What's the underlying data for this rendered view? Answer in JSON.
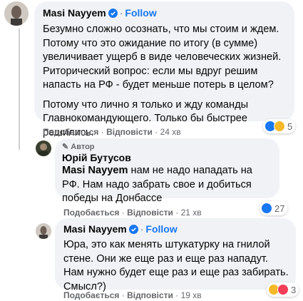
{
  "comment1": {
    "author": "Masi Nayyem",
    "follow_label": "Follow",
    "paragraph1": "Безумно сложно осознать, что мы стоим и ждем. Потому что это ожидание по итогу (в сумме) увеличивает ущерб в виде человеческих жизней. Риторический вопрос: если мы вдруг решим напасть на РФ - будет меньше потерь в целом?",
    "paragraph2": "Потому что лично я только и жду команды Главнокомандующего. Только бы быстрее решились.",
    "like_label": "Подобається",
    "reply_label": "Відповісти",
    "time": "24 хв",
    "reaction_count": "5"
  },
  "reply1": {
    "author_tag": "Автор",
    "author": "Юрій Бутусов",
    "mention": "Masi Nayyem",
    "text": " нам не надо нападать на РФ. Нам надо забрать свое и добиться победы на Донбассе",
    "like_label": "Подобається",
    "reply_label": "Відповісти",
    "time": "21 хв",
    "reaction_count": "27"
  },
  "reply2": {
    "author": "Masi Nayyem",
    "follow_label": "Follow",
    "text": "Юра, это как менять штукатурку на гнилой стене. Они же еще раз и еще раз нападут. Нам нужно будет еще раз и еще раз забирать. Смысл?)",
    "like_label": "Подобається",
    "reply_label": "Відповісти",
    "time": "19 хв",
    "reaction_count": "3"
  },
  "colors": {
    "bubble": "#f0f2f5",
    "link_blue": "#1877f2",
    "secondary_text": "#65676b",
    "like_blue": "#1877f2",
    "haha_yellow": "#f7b928"
  },
  "icons": [
    "verified-badge-icon",
    "like-reaction-icon",
    "haha-reaction-icon",
    "heart-reaction-icon"
  ]
}
